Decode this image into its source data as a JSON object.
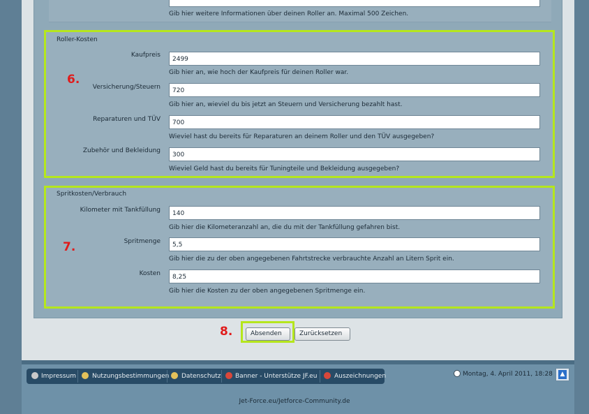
{
  "top_hint": "Gib hier weitere Informationen über deinen Roller an. Maximal 500 Zeichen.",
  "roller_kosten": {
    "legend": "Roller-Kosten",
    "annotation": "6.",
    "fields": [
      {
        "label": "Kaufpreis",
        "value": "2499",
        "hint": "Gib hier an, wie hoch der Kaufpreis für deinen Roller war."
      },
      {
        "label": "Versicherung/Steuern",
        "value": "720",
        "hint": "Gib hier an, wieviel du bis jetzt an Steuern und Versicherung bezahlt hast."
      },
      {
        "label": "Reparaturen und TÜV",
        "value": "700",
        "hint": "Wieviel hast du bereits für Reparaturen an deinem Roller und den TÜV ausgegeben?"
      },
      {
        "label": "Zubehör und Bekleidung",
        "value": "300",
        "hint": "Wieviel Geld hast du bereits für Tuningteile und Bekleidung ausgegeben?"
      }
    ]
  },
  "sprit": {
    "legend": "Spritkosten/Verbrauch",
    "annotation": "7.",
    "fields": [
      {
        "label": "Kilometer mit Tankfüllung",
        "value": "140",
        "hint": "Gib hier die Kilometeranzahl an, die du mit der Tankfüllung gefahren bist."
      },
      {
        "label": "Spritmenge",
        "value": "5,5",
        "hint": "Gib hier die zu der oben angegebenen Fahrtstrecke verbrauchte Anzahl an Litern Sprit ein."
      },
      {
        "label": "Kosten",
        "value": "8,25",
        "hint": "Gib hier die Kosten zu der oben angegebenen Spritmenge ein."
      }
    ]
  },
  "buttons": {
    "annotation": "8.",
    "submit": "Absenden",
    "reset": "Zurücksetzen"
  },
  "footer": {
    "nav": [
      "Impressum",
      "Nutzungsbestimmungen",
      "Datenschutz",
      "Banner - Unterstütze JF.eu",
      "Auszeichnungen"
    ],
    "date": "Montag, 4. April 2011, 18:28",
    "copyright": "Jet-Force.eu/Jetforce-Community.de"
  },
  "colors": {
    "highlight": "#b5e61d",
    "annotation": "#e01b1b",
    "navbar": "#284b66"
  }
}
